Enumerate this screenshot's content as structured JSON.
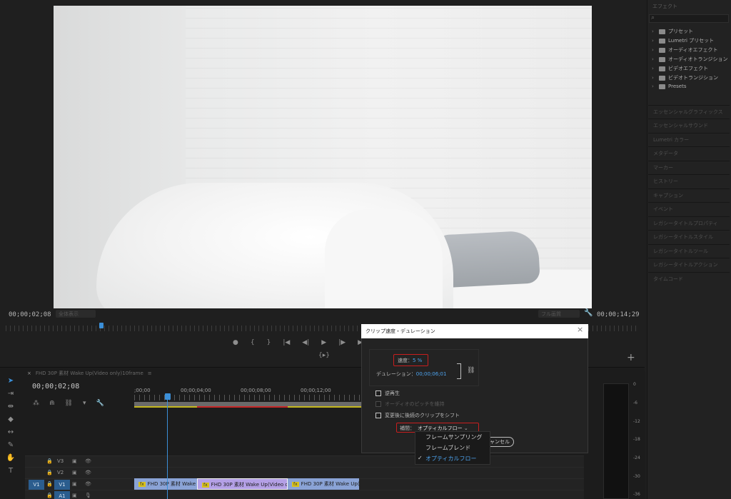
{
  "monitor": {
    "current_timecode": "00;00;02;08",
    "duration_timecode": "00;00;14;29",
    "fit_dropdown": "全体表示",
    "quality_dropdown": "フル画質",
    "transport": [
      "●",
      "{",
      "}",
      "|◀",
      "◀|",
      "▶",
      "|▶",
      "▶|"
    ],
    "insert_button": "{▸}",
    "add_button": "+"
  },
  "effects": {
    "title": "エフェクト",
    "items": [
      "プリセット",
      "Lumetri プリセット",
      "オーディオエフェクト",
      "オーディオトランジション",
      "ビデオエフェクト",
      "ビデオトランジション",
      "Presets"
    ],
    "panels": [
      "エッセンシャルグラフィックス",
      "エッセンシャルサウンド",
      "Lumetri カラー",
      "メタデータ",
      "マーカー",
      "ヒストリー",
      "キャプション",
      "イベント",
      "レガシータイトルプロパティ",
      "レガシータイトルスタイル",
      "レガシータイトルツール",
      "レガシータイトルアクション",
      "タイムコード"
    ]
  },
  "timeline": {
    "sequence_tab": "FHD 30P 素材 Wake Up(Video only)10frame",
    "close_glyph": "×",
    "menu_glyph": "≡",
    "timecode": "00;00;02;08",
    "ruler": [
      ";00;00",
      "00;00;04;00",
      "00;00;08;00",
      "00;00;12;00"
    ],
    "tracks": [
      {
        "name": "V3",
        "target": ""
      },
      {
        "name": "V2",
        "target": ""
      },
      {
        "name": "V1",
        "target": "V1",
        "source": "V1"
      },
      {
        "name": "A1",
        "target": "A1"
      }
    ],
    "clips": [
      {
        "label": "FHD 30P 素材 Wake",
        "fx": "fx"
      },
      {
        "label": "FHD 30P 素材 Wake Up(Video o",
        "fx": "fx"
      },
      {
        "label": "FHD 30P 素材 Wake Up(",
        "fx": "fx"
      }
    ],
    "meter_labels": [
      "0",
      "-6",
      "-12",
      "-18",
      "-24",
      "-30",
      "-36"
    ]
  },
  "dialog": {
    "title": "クリップ速度・デュレーション",
    "close": "×",
    "speed_label": "速度：",
    "speed_value": "5 %",
    "duration_label": "デュレーション：",
    "duration_value": "00;00;06;01",
    "link_icon": "🔗",
    "checkboxes": [
      {
        "label": "逆再生",
        "enabled": true
      },
      {
        "label": "オーディオのピッチを維持",
        "enabled": false
      },
      {
        "label": "変更後に後続のクリップをシフト",
        "enabled": true
      }
    ],
    "interp_label": "補間：",
    "interp_value": "オプティカルフロー",
    "interp_chevron": "⌄",
    "cancel_label": "キャンセル",
    "menu_options": [
      "フレームサンプリング",
      "フレームブレンド",
      "オプティカルフロー"
    ],
    "menu_check": "✓"
  }
}
